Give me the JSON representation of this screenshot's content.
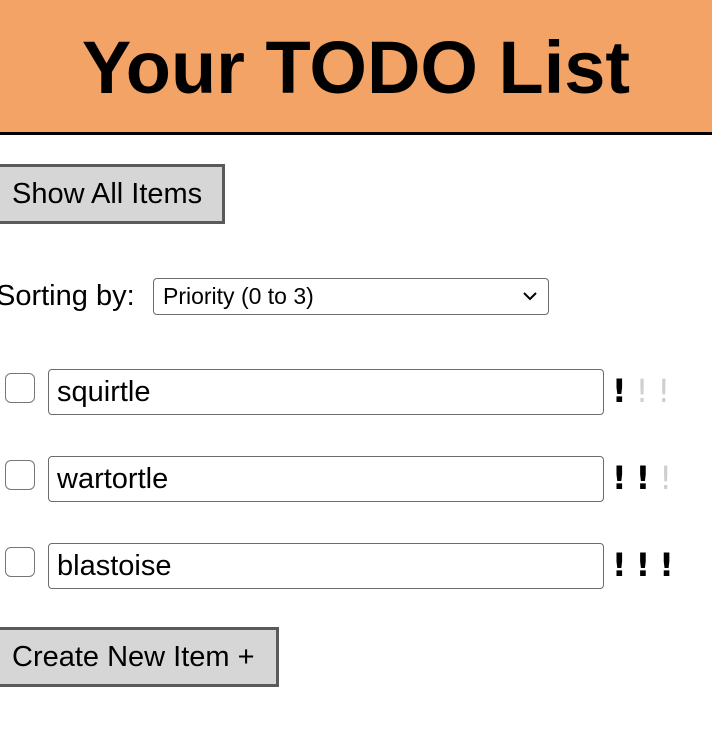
{
  "header": {
    "title": "Your TODO List",
    "background": "#f2a365"
  },
  "controls": {
    "show_all_label": "Show All Items",
    "sort_label": "Sorting by:",
    "sort_selected": "Priority (0 to 3)",
    "create_label": "Create New Item +"
  },
  "items": [
    {
      "text": "squirtle",
      "priority": 1,
      "checked": false
    },
    {
      "text": "wartortle",
      "priority": 2,
      "checked": false
    },
    {
      "text": "blastoise",
      "priority": 3,
      "checked": false
    }
  ],
  "priority_symbol": "!"
}
